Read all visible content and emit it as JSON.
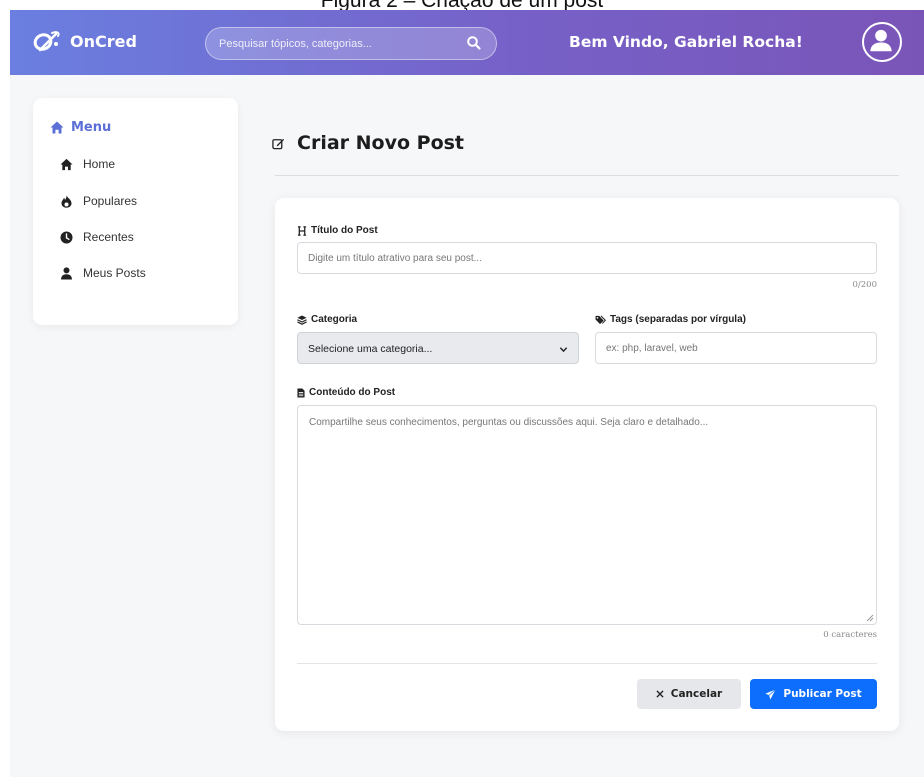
{
  "caption": "Figura 2 – Criação de um post",
  "navbar": {
    "brand": "OnCred",
    "search_placeholder": "Pesquisar tópicos, categorias...",
    "welcome": "Bem Vindo, Gabriel Rocha!",
    "gradient_start": "#6a7fe0",
    "gradient_end": "#7a55b8"
  },
  "sidebar": {
    "title": "Menu",
    "accent": "#5b6fd6",
    "items": [
      {
        "label": "Home",
        "icon": "home-icon"
      },
      {
        "label": "Populares",
        "icon": "fire-icon"
      },
      {
        "label": "Recentes",
        "icon": "clock-icon"
      },
      {
        "label": "Meus Posts",
        "icon": "user-icon"
      }
    ]
  },
  "page": {
    "title": "Criar Novo Post",
    "title_icon": "edit-icon"
  },
  "form": {
    "title_label": "Título do Post",
    "title_placeholder": "Digite um título atrativo para seu post...",
    "title_counter": "0/200",
    "category_label": "Categoria",
    "category_selected": "Selecione uma categoria...",
    "tags_label": "Tags (separadas por vírgula)",
    "tags_placeholder": "ex: php, laravel, web",
    "content_label": "Conteúdo do Post",
    "content_placeholder": "Compartilhe seus conhecimentos, perguntas ou discussões aqui. Seja claro e detalhado...",
    "content_counter": "0 caracteres"
  },
  "actions": {
    "cancel": "Cancelar",
    "publish": "Publicar Post",
    "publish_color": "#0d6efd"
  }
}
